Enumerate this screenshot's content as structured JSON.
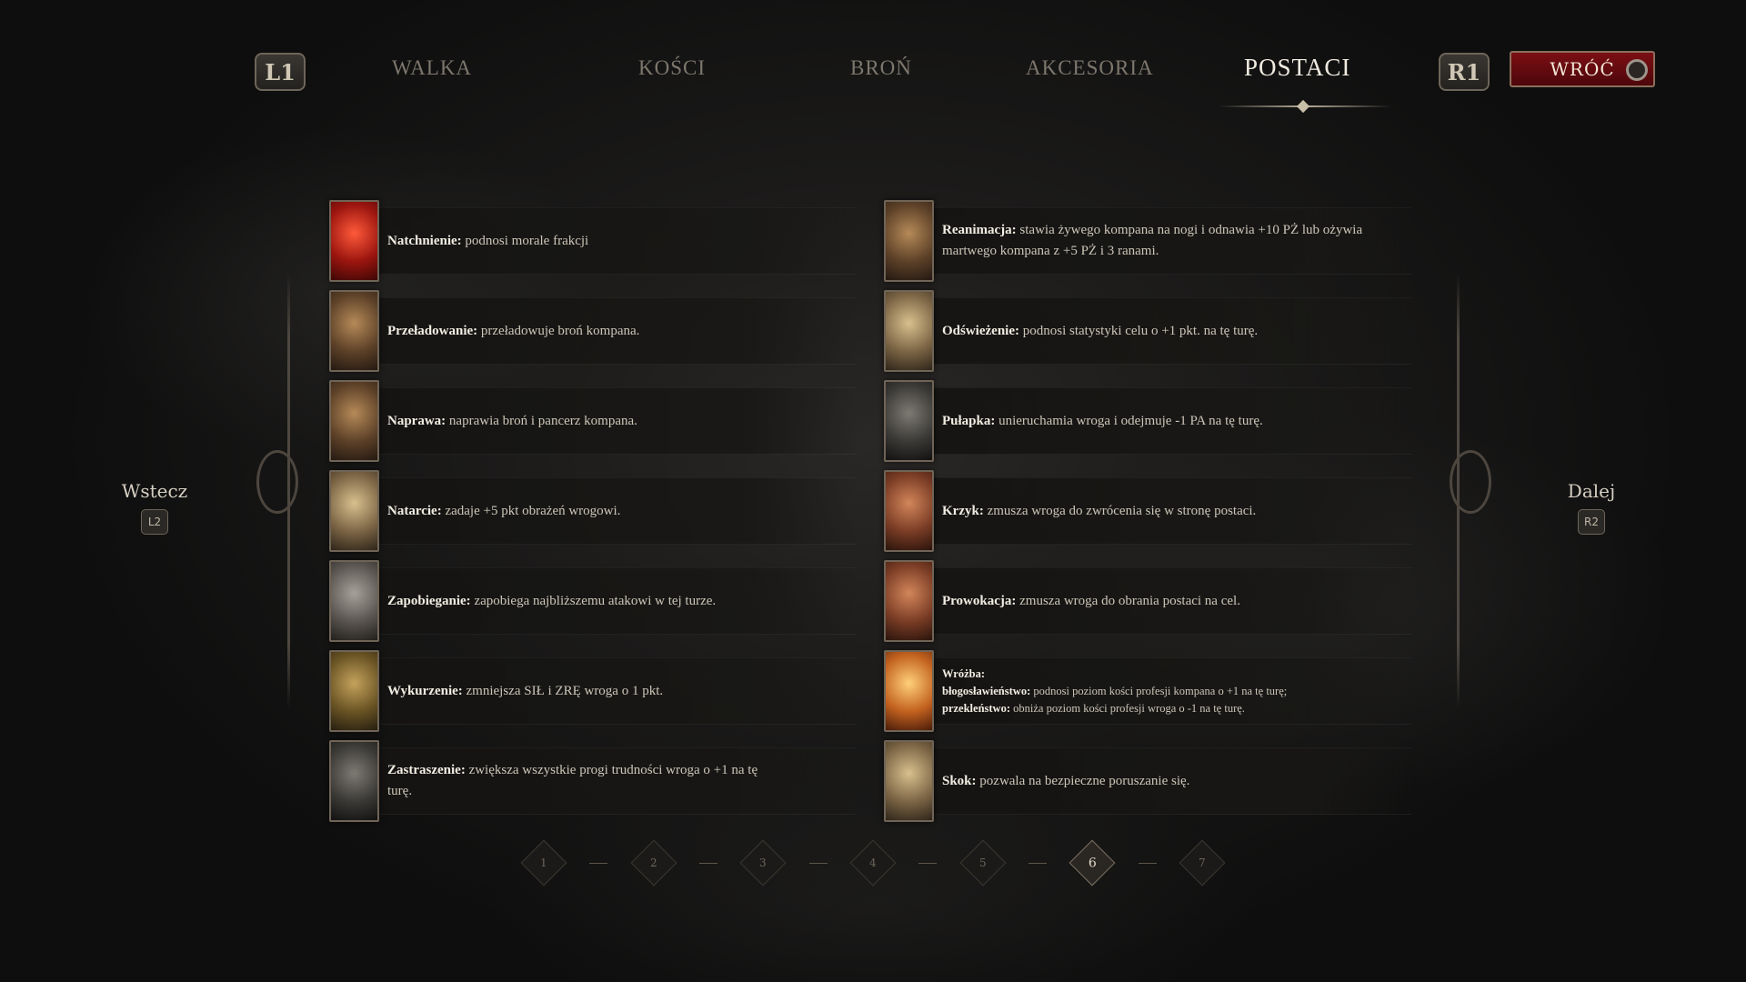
{
  "topbar": {
    "left_shoulder": "L1",
    "right_shoulder": "R1",
    "tabs": [
      {
        "label": "WALKA",
        "active": false
      },
      {
        "label": "KOŚCI",
        "active": false
      },
      {
        "label": "BROŃ",
        "active": false
      },
      {
        "label": "AKCESORIA",
        "active": false
      },
      {
        "label": "POSTACI",
        "active": true
      }
    ],
    "back_label": "WRÓĆ"
  },
  "nav": {
    "prev_label": "Wstecz",
    "prev_key": "L2",
    "next_label": "Dalej",
    "next_key": "R2"
  },
  "abilities_left": [
    {
      "name": "Natchnienie:",
      "desc": " podnosi morale frakcji",
      "portrait": "p-red"
    },
    {
      "name": "Przeładowanie:",
      "desc": " przeładowuje broń kompana.",
      "portrait": "p-brown"
    },
    {
      "name": "Naprawa:",
      "desc": " naprawia broń i pancerz kompana.",
      "portrait": "p-brown"
    },
    {
      "name": "Natarcie:",
      "desc": " zadaje +5 pkt obrażeń wrogowi.",
      "portrait": "p-tan"
    },
    {
      "name": "Zapobieganie:",
      "desc": " zapobiega najbliższemu atakowi w tej turze.",
      "portrait": "p-grey"
    },
    {
      "name": "Wykurzenie:",
      "desc": " zmniejsza SIŁ i ZRĘ wroga o 1 pkt.",
      "portrait": "p-olive"
    },
    {
      "name": "Zastraszenie:",
      "desc": " zwiększa wszystkie progi trudności wroga o +1 na tę turę.",
      "portrait": "p-dark"
    }
  ],
  "abilities_right": [
    {
      "name": "Reanimacja:",
      "desc": " stawia żywego kompana na nogi i odnawia +10 PŻ lub ożywia martwego kompana z +5 PŻ i 3 ranami.",
      "portrait": "p-brown"
    },
    {
      "name": "Odświeżenie:",
      "desc": " podnosi statystyki celu o +1 pkt. na tę turę.",
      "portrait": "p-tan"
    },
    {
      "name": "Pułapka:",
      "desc": " unieruchamia wroga i odejmuje -1 PA na tę turę.",
      "portrait": "p-dark"
    },
    {
      "name": "Krzyk:",
      "desc": " zmusza wroga do zwrócenia się w stronę postaci.",
      "portrait": "p-rust"
    },
    {
      "name": "Prowokacja:",
      "desc": " zmusza wroga do obrania postaci na cel.",
      "portrait": "p-rust"
    },
    {
      "name": "Skok:",
      "desc": " pozwala na bezpieczne poruszanie się.",
      "portrait": "p-tan"
    }
  ],
  "omen": {
    "title": "Wróżba:",
    "blessing_name": "błogosławieństwo:",
    "blessing_desc": " podnosi poziom kości profesji kompana o +1 na tę turę;",
    "curse_name": "przekleństwo:",
    "curse_desc": " obniża poziom kości profesji wroga o -1 na tę turę.",
    "portrait": "p-fire"
  },
  "pagination": {
    "pages": [
      "1",
      "2",
      "3",
      "4",
      "5",
      "6",
      "7"
    ],
    "current": "6"
  }
}
